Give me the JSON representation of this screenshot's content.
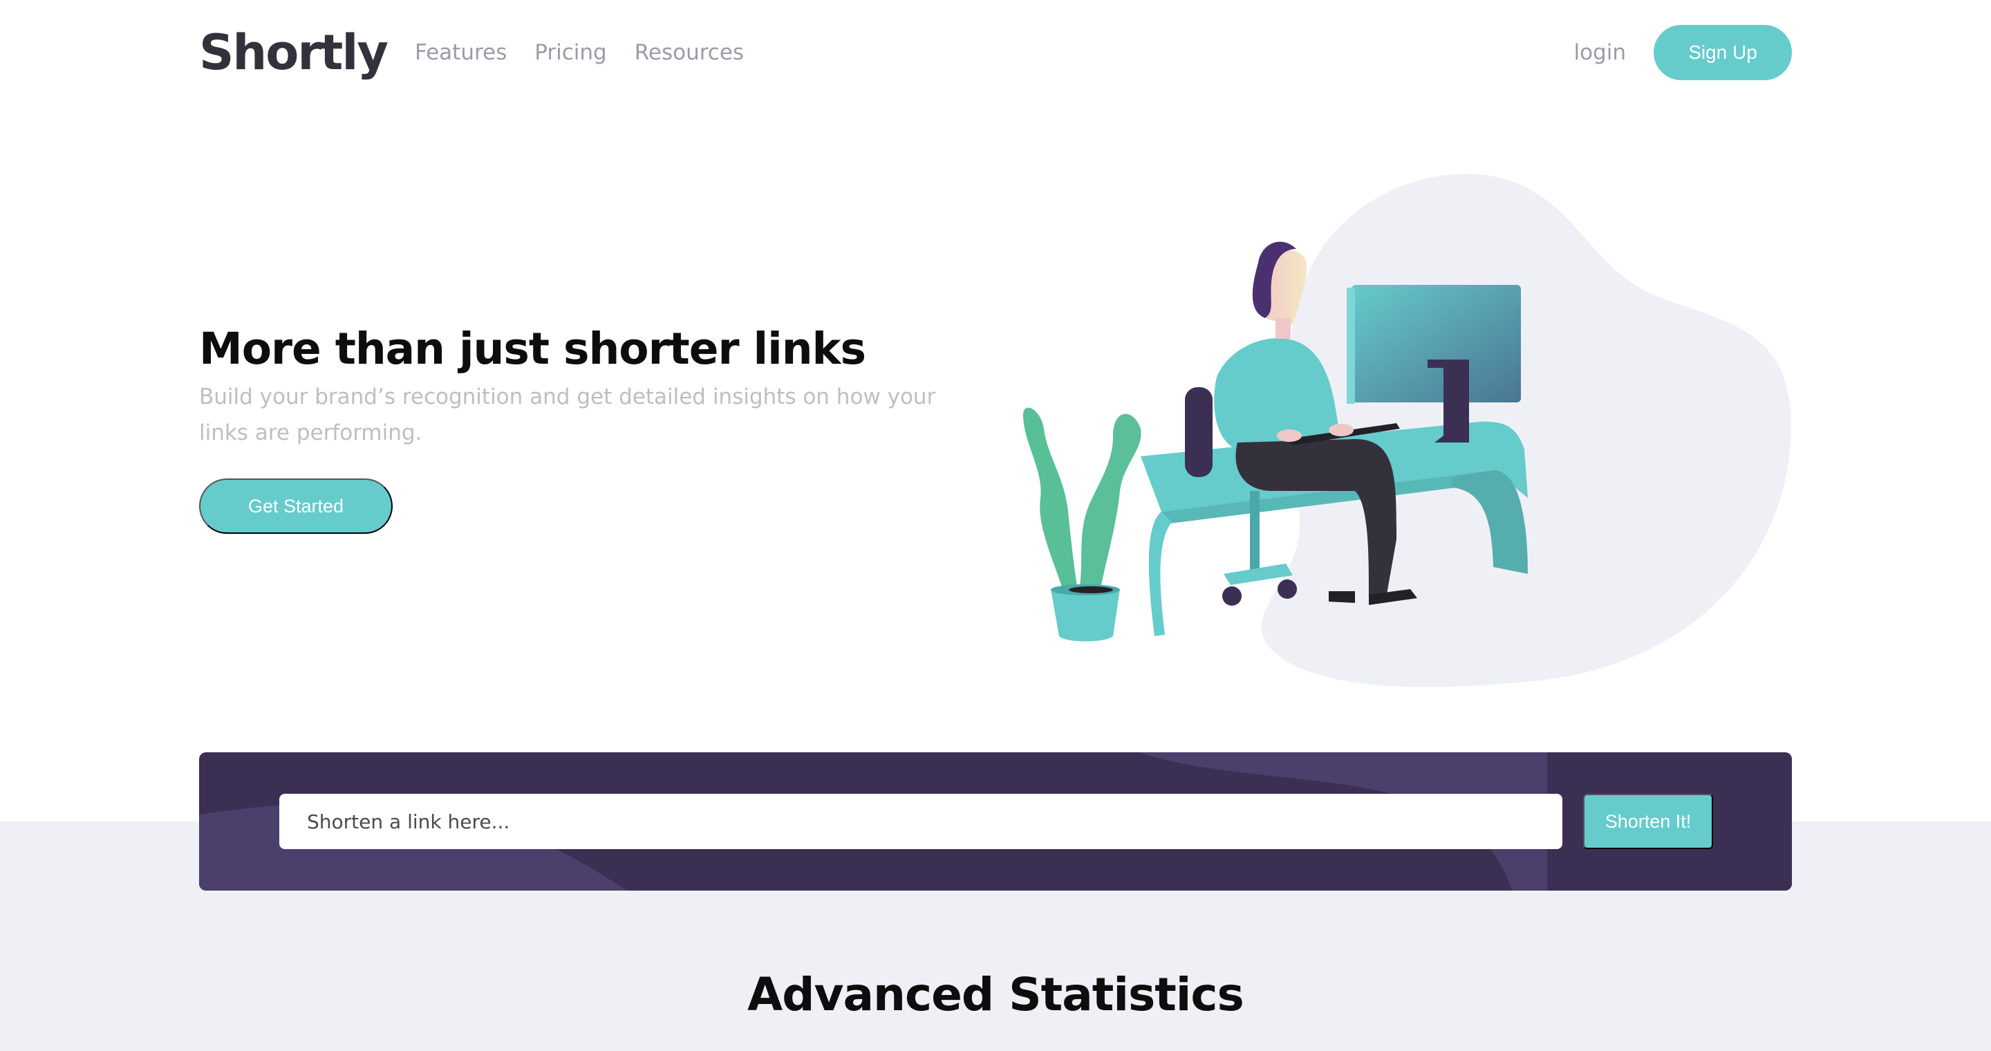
{
  "nav": {
    "logo": "Shortly",
    "links": [
      "Features",
      "Pricing",
      "Resources"
    ],
    "login_label": "login",
    "signup_label": "Sign Up"
  },
  "hero": {
    "title": "More than just shorter links",
    "subtitle": "Build your brand’s recognition and get detailed insights on how your links are performing.",
    "cta_label": "Get Started",
    "illustration": "person-working-at-desk-illustration"
  },
  "shorten": {
    "placeholder": "Shorten a link here...",
    "button_label": "Shorten It!"
  },
  "stats": {
    "title": "Advanced Statistics"
  },
  "colors": {
    "cyan": "#66cbcb",
    "dark_violet": "#3b3054",
    "violet": "#4b3f6b",
    "grayish_violet": "#9e9aa7",
    "light_bg": "#eff0f6"
  }
}
